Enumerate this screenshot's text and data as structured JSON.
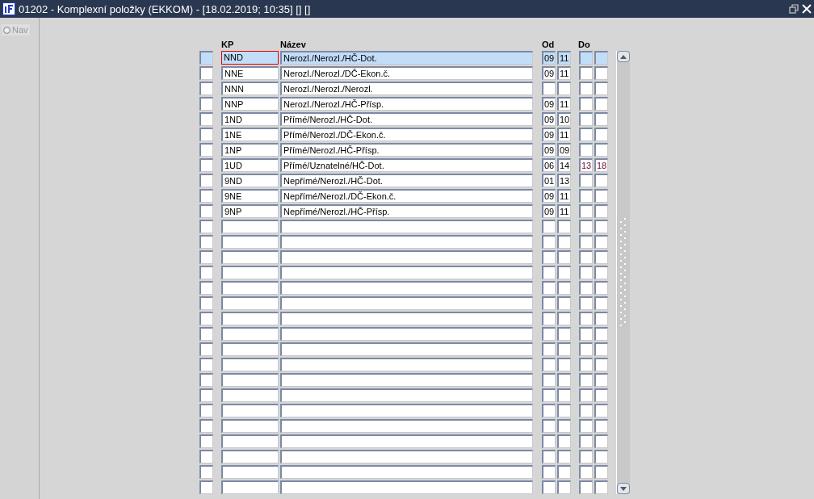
{
  "window": {
    "title": "01202 - Komplexní položky (EKKOM) - [18.02.2019; 10:35] [] []"
  },
  "sidebar": {
    "items": [
      {
        "label": "Nav",
        "selected": false
      }
    ]
  },
  "table": {
    "columns": [
      "KP",
      "Název",
      "Od",
      "Do"
    ],
    "rows": [
      {
        "selected": true,
        "focused": true,
        "kp": "NND",
        "name": "Nerozl./Nerozl./HČ-Dot.",
        "od": [
          "09",
          "11"
        ],
        "do": []
      },
      {
        "selected": false,
        "focused": false,
        "kp": "NNE",
        "name": "Nerozl./Nerozl./DČ-Ekon.č.",
        "od": [
          "09",
          "11"
        ],
        "do": []
      },
      {
        "selected": false,
        "focused": false,
        "kp": "NNN",
        "name": "Nerozl./Nerozl./Nerozl.",
        "od": [],
        "do": []
      },
      {
        "selected": false,
        "focused": false,
        "kp": "NNP",
        "name": "Nerozl./Nerozl./HČ-Přísp.",
        "od": [
          "09",
          "11"
        ],
        "do": []
      },
      {
        "selected": false,
        "focused": false,
        "kp": "1ND",
        "name": "Přímé/Nerozl./HČ-Dot.",
        "od": [
          "09",
          "10"
        ],
        "do": []
      },
      {
        "selected": false,
        "focused": false,
        "kp": "1NE",
        "name": "Přímé/Nerozl./DČ-Ekon.č.",
        "od": [
          "09",
          "11"
        ],
        "do": []
      },
      {
        "selected": false,
        "focused": false,
        "kp": "1NP",
        "name": "Přímé/Nerozl./HČ-Přísp.",
        "od": [
          "09",
          "09"
        ],
        "do": []
      },
      {
        "selected": false,
        "focused": false,
        "kp": "1UD",
        "name": "Přímé/Uznatelné/HČ-Dot.",
        "od": [
          "06",
          "14"
        ],
        "do": [
          "13",
          "18"
        ]
      },
      {
        "selected": false,
        "focused": false,
        "kp": "9ND",
        "name": "Nepřímé/Nerozl./HČ-Dot.",
        "od": [
          "01",
          "13"
        ],
        "do": []
      },
      {
        "selected": false,
        "focused": false,
        "kp": "9NE",
        "name": "Nepřímé/Nerozl./DČ-Ekon.č.",
        "od": [
          "09",
          "11"
        ],
        "do": []
      },
      {
        "selected": false,
        "focused": false,
        "kp": "9NP",
        "name": "Nepřímé/Nerozl./HČ-Přísp.",
        "od": [
          "09",
          "11"
        ],
        "do": []
      },
      {
        "selected": false
      },
      {
        "selected": false
      },
      {
        "selected": false
      },
      {
        "selected": false
      },
      {
        "selected": false
      },
      {
        "selected": false
      },
      {
        "selected": false
      },
      {
        "selected": false
      },
      {
        "selected": false
      },
      {
        "selected": false
      },
      {
        "selected": false
      },
      {
        "selected": false
      },
      {
        "selected": false
      },
      {
        "selected": false
      },
      {
        "selected": false
      },
      {
        "selected": false
      },
      {
        "selected": false
      },
      {
        "selected": false
      }
    ]
  }
}
